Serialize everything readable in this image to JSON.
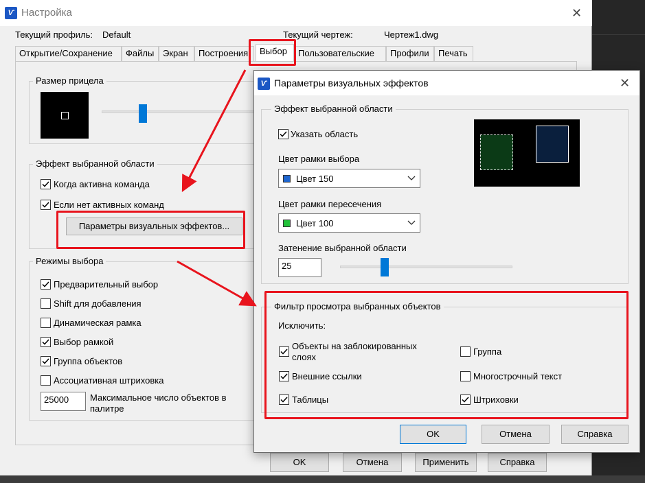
{
  "main_window": {
    "title": "Настройка",
    "close_glyph": "✕",
    "app_icon": "pen-logo-icon",
    "profile_label": "Текущий профиль:",
    "profile_value": "Default",
    "drawing_label": "Текущий чертеж:",
    "drawing_value": "Чертеж1.dwg",
    "tabs": [
      {
        "label": "Открытие/Сохранение"
      },
      {
        "label": "Файлы"
      },
      {
        "label": "Экран"
      },
      {
        "label": "Построения"
      },
      {
        "label": "Выбор",
        "active": true
      },
      {
        "label": "Пользовательские"
      },
      {
        "label": "Профили"
      },
      {
        "label": "Печать"
      }
    ],
    "aperture": {
      "title": "Размер прицела",
      "slider_fraction": 0.2
    },
    "selection_effect": {
      "title": "Эффект выбранной области",
      "when_command_active": "Когда активна команда",
      "when_no_command": "Если нет активных команд",
      "visual_effects_button": "Параметры визуальных эффектов..."
    },
    "selection_modes": {
      "title": "Режимы выбора",
      "items": [
        {
          "label": "Предварительный выбор",
          "checked": true
        },
        {
          "label": "Shift для добавления",
          "checked": false
        },
        {
          "label": "Динамическая рамка",
          "checked": false
        },
        {
          "label": "Выбор рамкой",
          "checked": true
        },
        {
          "label": "Группа объектов",
          "checked": true
        },
        {
          "label": "Ассоциативная штриховка",
          "checked": false
        }
      ],
      "max_objects_value": "25000",
      "max_objects_label_line1": "Максимальное число объектов в",
      "max_objects_label_line2": "палитре"
    },
    "buttons": {
      "ok": "OK",
      "cancel": "Отмена",
      "apply": "Применить",
      "help": "Справка"
    }
  },
  "dialog": {
    "title": "Параметры визуальных эффектов",
    "close_glyph": "✕",
    "effect_group": {
      "title": "Эффект выбранной области",
      "indicate_area": "Указать область",
      "window_color_label": "Цвет рамки выбора",
      "window_color_value": "Цвет 150",
      "window_color_hex": "#1e66d0",
      "crossing_color_label": "Цвет рамки пересечения",
      "crossing_color_value": "Цвет 100",
      "crossing_color_hex": "#22c23a",
      "shading_label": "Затенение выбранной области",
      "shading_value": "25",
      "shading_slider_fraction": 0.25
    },
    "filter_group": {
      "title": "Фильтр просмотра выбранных объектов",
      "exclude_label": "Исключить:",
      "left_items": [
        {
          "label_line1": "Объекты на заблокированных",
          "label_line2": "слоях",
          "checked": true
        },
        {
          "label_line1": "Внешние ссылки",
          "checked": true
        },
        {
          "label_line1": "Таблицы",
          "checked": true
        }
      ],
      "right_items": [
        {
          "label": "Группа",
          "checked": false
        },
        {
          "label": "Многострочный текст",
          "checked": false
        },
        {
          "label": "Штриховки",
          "checked": true
        }
      ]
    },
    "buttons": {
      "ok": "OK",
      "cancel": "Отмена",
      "help": "Справка"
    }
  },
  "colors": {
    "highlight_red": "#e8141d",
    "accent_blue": "#0078d7"
  }
}
